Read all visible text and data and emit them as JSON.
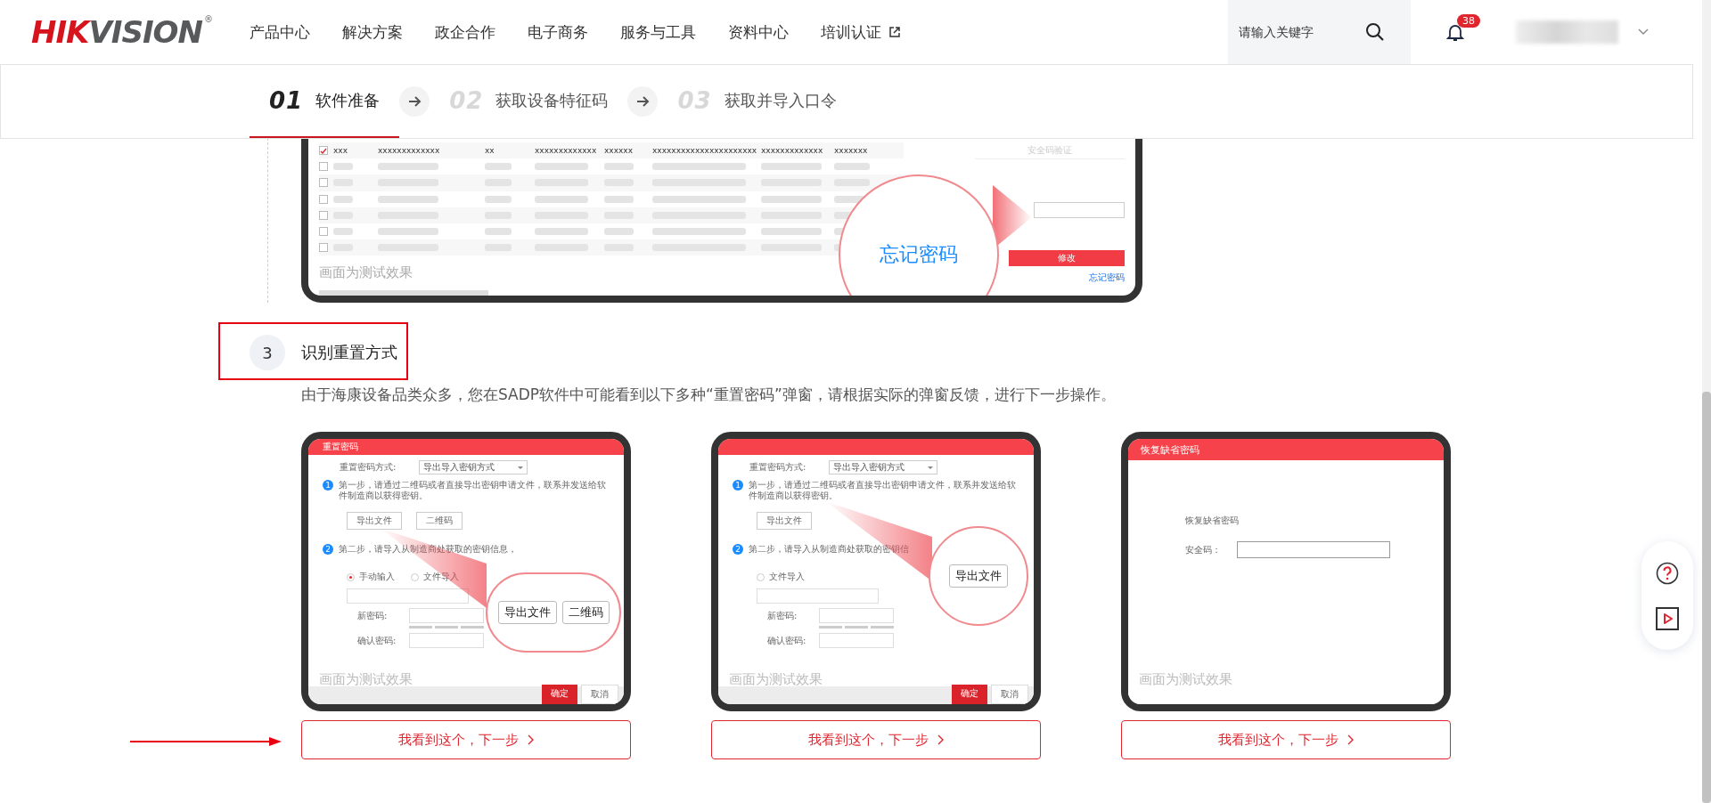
{
  "header": {
    "logo": {
      "primary": "HIK",
      "secondary": "VISION",
      "mark": "®"
    },
    "nav": [
      {
        "label": "产品中心",
        "external": false
      },
      {
        "label": "解决方案",
        "external": false
      },
      {
        "label": "政企合作",
        "external": false
      },
      {
        "label": "电子商务",
        "external": false
      },
      {
        "label": "服务与工具",
        "external": false
      },
      {
        "label": "资料中心",
        "external": false
      },
      {
        "label": "培训认证",
        "external": true
      }
    ],
    "search": {
      "placeholder": "请输入关键字"
    },
    "notifications": {
      "count": "38"
    }
  },
  "steps": [
    {
      "number": "01",
      "label": "软件准备",
      "selected": true
    },
    {
      "number": "02",
      "label": "获取设备特征码",
      "selected": false
    },
    {
      "number": "03",
      "label": "获取并导入口令",
      "selected": false
    }
  ],
  "top_preview": {
    "checked": true,
    "rows": [
      {
        "checked": false
      },
      {
        "checked": false
      },
      {
        "checked": false
      },
      {
        "checked": false
      },
      {
        "checked": false
      },
      {
        "checked": false
      }
    ],
    "header_cells": [
      "xxx",
      "xxxxxxxxxxxxx",
      "xx",
      "xxxxxxxxxxxxx",
      "xxxxxx",
      "xxxxxxxxxxxxxxxxxxxxxx",
      "xxxxxxxxxxxxx",
      "xxxxxxx"
    ],
    "panel_title": "安全码验证",
    "magnifier": "忘记密码",
    "button": "修改",
    "link": "忘记密码",
    "caption": "画面为测试效果"
  },
  "section": {
    "number": "3",
    "title": "识别重置方式",
    "description": "由于海康设备品类众多，您在SADP软件中可能看到以下多种“重置密码”弹窗，请根据实际的弹窗反馈，进行下一步操作。"
  },
  "cards": [
    {
      "kind": "key-export",
      "title": "重置密码",
      "method_label": "重置密码方式:",
      "method_value": "导出导入密钥方式",
      "steps": [
        {
          "number": "1",
          "text": "第一步，请通过二维码或者直接导出密钥申请文件，联系并发送给软件制造商以获得密钥。"
        },
        {
          "number": "2",
          "text": "第二步，请导入从制造商处获取的密钥信息，"
        }
      ],
      "buttons": [
        "导出文件",
        "二维码"
      ],
      "magnified": [
        "导出文件",
        "二维码"
      ],
      "radios": [
        {
          "label": "手动输入",
          "selected": true
        },
        {
          "label": "文件导入",
          "selected": false
        }
      ],
      "fields": [
        "新密码:",
        "确认密码:"
      ],
      "footer_buttons": [
        "确定",
        "取消"
      ],
      "caption": "画面为测试效果",
      "action": "我看到这个，下一步"
    },
    {
      "kind": "key-export",
      "method_label": "重置密码方式:",
      "method_value": "导出导入密钥方式",
      "steps": [
        {
          "number": "1",
          "text": "第一步，请通过二维码或者直接导出密钥申请文件，联系并发送给软件制造商以获得密钥。"
        },
        {
          "number": "2",
          "text": "第二步，请导入从制造商处获取的密钥信"
        }
      ],
      "buttons": [
        "导出文件"
      ],
      "magnified": [
        "导出文件"
      ],
      "radios": [
        {
          "label": "文件导入",
          "selected": false
        }
      ],
      "fields": [
        "新密码:",
        "确认密码:"
      ],
      "footer_buttons": [
        "确定",
        "取消"
      ],
      "caption": "画面为测试效果",
      "action": "我看到这个，下一步"
    },
    {
      "kind": "default-password",
      "title": "恢复缺省密码",
      "heading": "恢复缺省密码",
      "field_label": "安全码：",
      "caption": "画面为测试效果",
      "action": "我看到这个，下一步"
    }
  ]
}
